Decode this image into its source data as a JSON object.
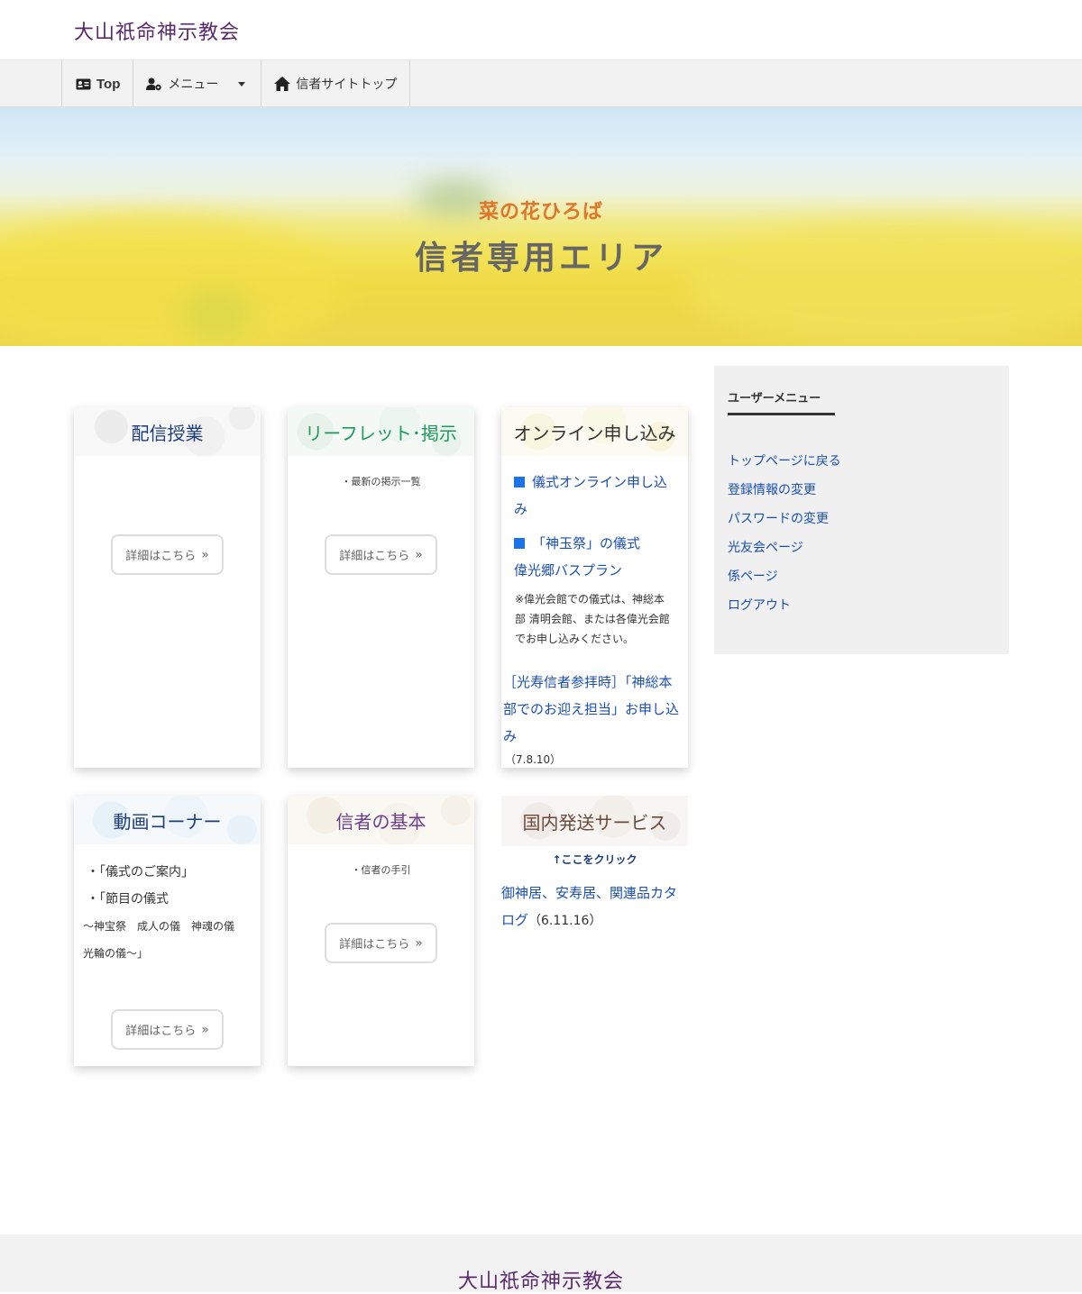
{
  "site": {
    "name": "大山祇命神示教会"
  },
  "nav": {
    "top_label": "Top",
    "menu_label": "メニュー",
    "home_label": "信者サイトトップ"
  },
  "hero": {
    "subtitle": "菜の花ひろば",
    "title": "信者専用エリア"
  },
  "cards": {
    "streaming": {
      "title": "配信授業",
      "button": "詳細はこちら"
    },
    "leaflet": {
      "title": "リーフレット･掲示",
      "note": "・最新の掲示一覧",
      "button": "詳細はこちら"
    },
    "online": {
      "title": "オンライン申し込み",
      "link1": "儀式オンライン申し込み",
      "link2": "「神玉祭」の儀式",
      "link3": "偉光郷バスプラン",
      "note": "※偉光会館での儀式は、神総本部 清明会館、または各偉光会館でお申し込みください。",
      "link4": "［光寿信者参拝時］「神総本部でのお迎え担当」お申し込み",
      "date4": "（7.8.10）"
    },
    "video": {
      "title": "動画コーナー",
      "item1": "・「儀式のご案内」",
      "item2": "・「節目の儀式",
      "item3": "〜神宝祭　成人の儀　神魂の儀",
      "item4": "光輪の儀〜」",
      "button": "詳細はこちら"
    },
    "basics": {
      "title": "信者の基本",
      "note": "・信者の手引",
      "button": "詳細はこちら"
    },
    "shipping": {
      "title": "国内発送サービス",
      "click_note": "↑ここをクリック",
      "link": "御神居、安寿居、関連品カタログ",
      "date": "（6.11.16）"
    }
  },
  "sidebar": {
    "title": "ユーザーメニュー",
    "items": [
      "トップページに戻る",
      "登録情報の変更",
      "パスワードの変更",
      "光友会ページ",
      "係ページ",
      "ログアウト"
    ]
  },
  "colors": {
    "brand": "#5b2a6e",
    "link": "#1a4fb0",
    "hero_subtitle": "#e0762a",
    "streaming_title": "#1d3c7a",
    "leaflet_title": "#1f9a5e",
    "online_title": "#333333",
    "video_title": "#1d3c7a",
    "basics_title": "#6b3f8a",
    "shipping_title": "#6b4a3a"
  }
}
